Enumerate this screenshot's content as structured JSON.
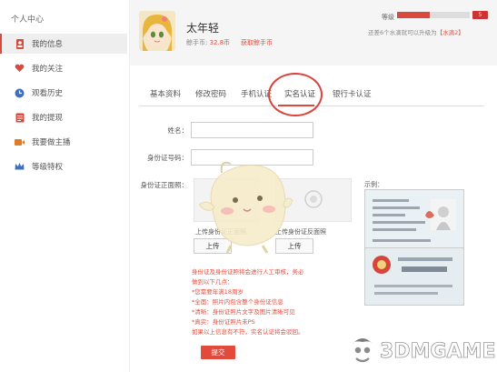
{
  "sidebar": {
    "title": "个人中心",
    "items": [
      {
        "label": "我的信息",
        "icon": "user-icon",
        "active": true
      },
      {
        "label": "我的关注",
        "icon": "heart-icon",
        "active": false
      },
      {
        "label": "观看历史",
        "icon": "history-icon",
        "active": false
      },
      {
        "label": "我的提现",
        "icon": "withdraw-icon",
        "active": false
      },
      {
        "label": "我要做主播",
        "icon": "video-icon",
        "active": false
      },
      {
        "label": "等级特权",
        "icon": "crown-icon",
        "active": false
      }
    ]
  },
  "profile": {
    "username": "太年轻",
    "coin_label": "鲸手币:",
    "coin_value": "32.8币",
    "get_coin": "获取鲸手币",
    "level_label": "等级",
    "level_progress": 0.45,
    "level_badge": "5",
    "level_hint_prefix": "还差6个水滴就可以升级为",
    "level_hint_target": "【水滴2】"
  },
  "tabs": [
    "基本资料",
    "修改密码",
    "手机认证",
    "实名认证",
    "银行卡认证"
  ],
  "active_tab": "实名认证",
  "form": {
    "name_label": "姓名：",
    "id_label": "身份证号码：",
    "photo_label": "身份证正面照：",
    "upload_front_label": "上传身份证正面照",
    "upload_back_label": "上传身份证反面照",
    "upload_button": "上传",
    "example_label": "示例："
  },
  "notes": [
    "身份证及身份证照将会进行人工审核，务必",
    "做到以下几点：",
    "*您需要年满18周岁",
    "*全面：照片内包含整个身份证信息",
    "*清晰：身份证照片文字及图片清晰可见",
    "*真实：身份证照片未PS",
    "如果以上信息有不符，实名认证将会驳回。"
  ],
  "submit": "提交",
  "watermark": "3DMGAME",
  "colors": {
    "accent": "#d94a3d",
    "sidebar_active": "#eeeeee"
  }
}
